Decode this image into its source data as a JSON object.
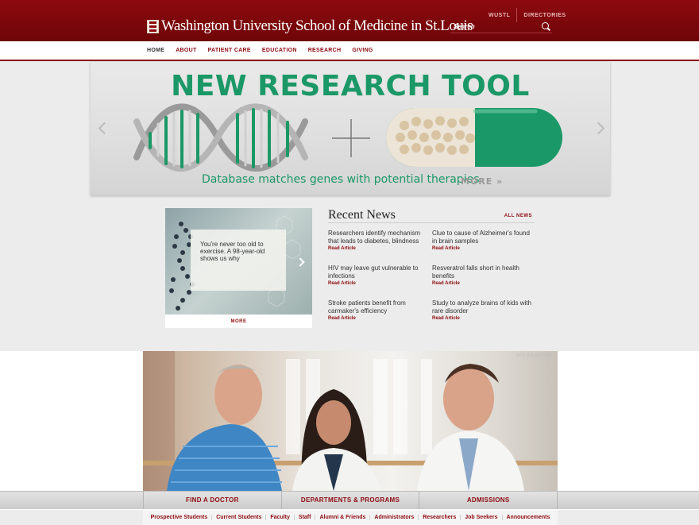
{
  "header": {
    "logo_text": "Washington University School of Medicine in St.Louis",
    "util_links": [
      "WUSTL",
      "DIRECTORIES"
    ],
    "search_placeholder": "Search"
  },
  "nav": {
    "items": [
      "HOME",
      "ABOUT",
      "PATIENT CARE",
      "EDUCATION",
      "RESEARCH",
      "GIVING"
    ]
  },
  "hero": {
    "title": "NEW RESEARCH TOOL",
    "subtitle": "Database matches genes with potential therapies",
    "more": "MORE »"
  },
  "feature": {
    "caption": "You're never too old to exercise. A 98-year-old shows us why",
    "more": "MORE"
  },
  "news": {
    "title": "Recent News",
    "all_link": "ALL NEWS",
    "read_label": "Read Article",
    "items": [
      {
        "headline": "Researchers identify mechanism that leads to diabetes, blindness"
      },
      {
        "headline": "Clue to cause of Alzheimer's found in brain samples"
      },
      {
        "headline": "HIV may leave gut vulnerable to infections"
      },
      {
        "headline": "Resveratrol falls short in health benefits"
      },
      {
        "headline": "Stroke patients benefit from carmaker's efficiency"
      },
      {
        "headline": "Study to analyze brains of kids with rare disorder"
      }
    ]
  },
  "photo": {
    "label": "NOT ADJUSTED"
  },
  "actions": [
    "FIND A DOCTOR",
    "DEPARTMENTS & PROGRAMS",
    "ADMISSIONS"
  ],
  "audiences": [
    "Prospective Students",
    "Current Students",
    "Faculty",
    "Staff",
    "Alumni & Friends",
    "Administrators",
    "Researchers",
    "Job Seekers",
    "Announcements"
  ],
  "colors": {
    "brand": "#8d0a0f",
    "accent": "#1b9867"
  }
}
